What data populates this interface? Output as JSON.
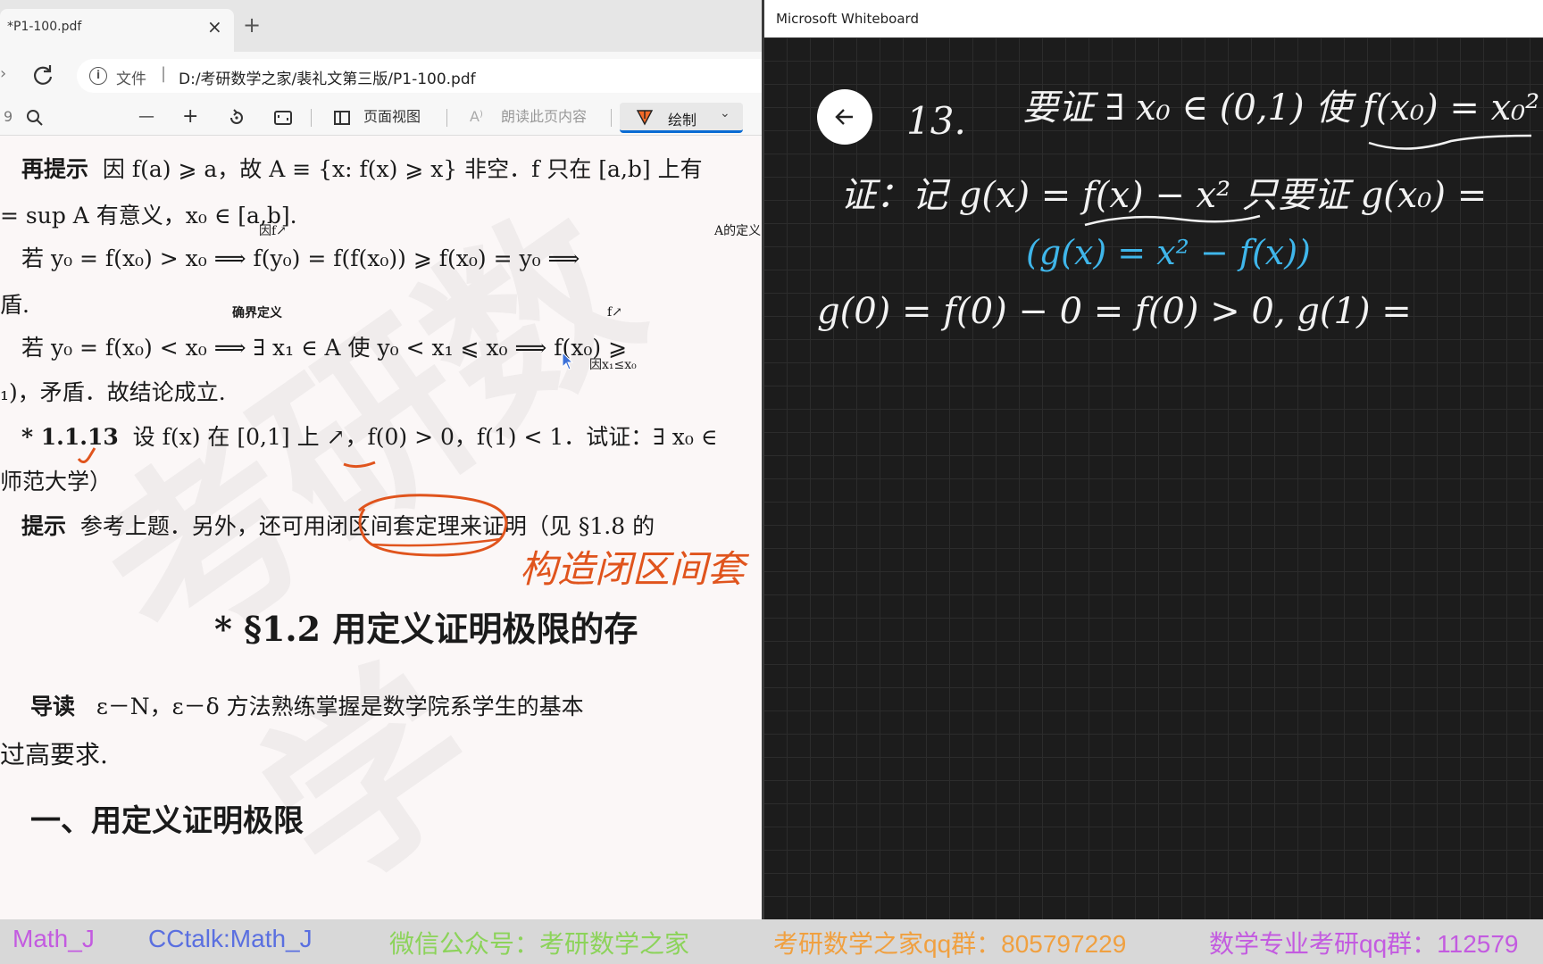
{
  "browser": {
    "tab_title": "*P1-100.pdf",
    "tab_close": "×",
    "new_tab": "+",
    "address_prefix": "文件",
    "address_separator": "|",
    "address_url": "D:/考研数学之家/裴礼文第三版/P1-100.pdf"
  },
  "pdf_toolbar": {
    "zoom_out": "—",
    "zoom_in": "+",
    "page_view": "页面视图",
    "read_aloud": "朗读此页内容",
    "draw": "绘制",
    "draw_chevron": "⌄"
  },
  "pdf_page": {
    "lines": [
      {
        "prefix": "再提示",
        "text": "因 f(a) ⩾ a，故 A ≡ {x: f(x) ⩾ x} 非空．f 只在 [a,b] 上有"
      },
      {
        "prefix": "",
        "text": "= sup A 有意义，x₀ ∈ [a,b]."
      },
      {
        "prefix": "",
        "text": "若 y₀ = f(x₀) > x₀ ⟹ f(y₀) = f(f(x₀)) ⩾ f(x₀) = y₀ ⟹"
      },
      {
        "prefix": "",
        "text": "盾."
      },
      {
        "prefix": "",
        "text": "若 y₀ = f(x₀) < x₀ ⟹ ∃ x₁ ∈ A 使 y₀ < x₁ ⩽ x₀ ⟹ f(x₀) ⩾"
      },
      {
        "prefix": "",
        "text": "₁)，矛盾．故结论成立."
      },
      {
        "prefix": "* 1.1.13",
        "text": "设 f(x) 在 [0,1] 上 ↗，f(0) > 0，f(1) < 1．试证：∃ x₀ ∈"
      },
      {
        "prefix": "",
        "text": "师范大学）"
      },
      {
        "prefix": "提示",
        "text": "参考上题．另外，还可用闭区间套定理来证明（见 §1.8 的"
      },
      {
        "prefix": "",
        "text": "导读"
      }
    ],
    "arrow_labels": {
      "a1": "因f↗",
      "a2": "A的定义",
      "a3": "确界定义",
      "a4": "f↗",
      "a5": "因x₁≤x₀"
    },
    "section_title": "* §1.2   用定义证明极限的存",
    "guide_label": "导读",
    "guide_text": "ε－N，ε－δ 方法熟练掌握是数学院系学生的基本",
    "guide_text2": "过高要求.",
    "subsection": "一、用定义证明极限",
    "annotation": "构造闭区间套",
    "watermark": "考研数学"
  },
  "whiteboard": {
    "title": "Microsoft Whiteboard",
    "ink": {
      "problem_no": "13.",
      "goal": "要证 ∃ x₀ ∈ (0,1) 使 f(x₀) = x₀²",
      "proof_line": "证：记 g(x) = f(x) − x²   只要证  g(x₀) =",
      "alt_def": "(g(x) = x² − f(x))",
      "g0_line": "g(0) = f(0) − 0 = f(0) > 0,   g(1) ="
    },
    "colors": {
      "ink_white": "#f2f2f2",
      "ink_blue": "#3fb6ea"
    }
  },
  "banner": {
    "items": [
      {
        "text": "Math_J",
        "color": "#c35be0"
      },
      {
        "text": "CCtalk:Math_J",
        "color": "#5a6fe0"
      },
      {
        "text": "微信公众号：考研数学之家",
        "color": "#8cd35a"
      },
      {
        "text": "考研数学之家qq群：805797229",
        "color": "#f0a040"
      },
      {
        "text": "数学专业考研qq群：112579",
        "color": "#c35be0"
      }
    ]
  }
}
